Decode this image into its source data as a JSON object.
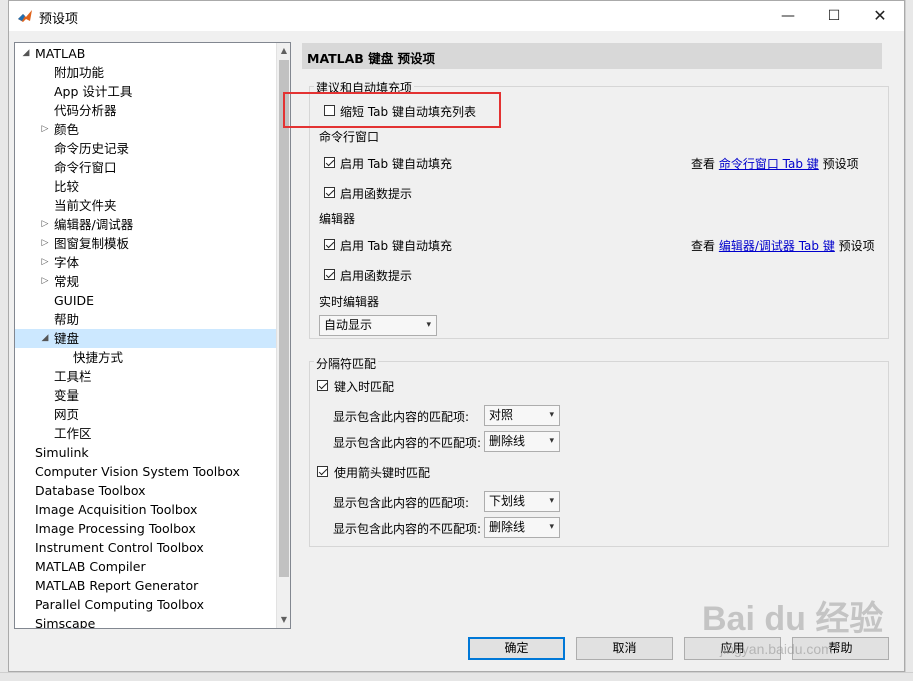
{
  "window": {
    "title": "预设项",
    "minimize": "—",
    "maximize": "☐",
    "close": "✕"
  },
  "tree": {
    "items": [
      {
        "label": "MATLAB",
        "expander": "◢"
      },
      {
        "label": "附加功能"
      },
      {
        "label": "App 设计工具"
      },
      {
        "label": "代码分析器"
      },
      {
        "label": "颜色",
        "expander": "▷"
      },
      {
        "label": "命令历史记录"
      },
      {
        "label": "命令行窗口"
      },
      {
        "label": "比较"
      },
      {
        "label": "当前文件夹"
      },
      {
        "label": "编辑器/调试器",
        "expander": "▷"
      },
      {
        "label": "图窗复制模板",
        "expander": "▷"
      },
      {
        "label": "字体",
        "expander": "▷"
      },
      {
        "label": "常规",
        "expander": "▷"
      },
      {
        "label": "GUIDE"
      },
      {
        "label": "帮助"
      },
      {
        "label": "键盘",
        "expander": "◢",
        "selected": true
      },
      {
        "label": "快捷方式"
      },
      {
        "label": "工具栏"
      },
      {
        "label": "变量"
      },
      {
        "label": "网页"
      },
      {
        "label": "工作区"
      },
      {
        "label": "Simulink"
      },
      {
        "label": "Computer Vision System Toolbox"
      },
      {
        "label": "Database Toolbox"
      },
      {
        "label": "Image Acquisition Toolbox"
      },
      {
        "label": "Image Processing Toolbox"
      },
      {
        "label": "Instrument Control Toolbox"
      },
      {
        "label": "MATLAB Compiler"
      },
      {
        "label": "MATLAB Report Generator"
      },
      {
        "label": "Parallel Computing Toolbox"
      },
      {
        "label": "Simscape"
      }
    ]
  },
  "panel": {
    "header": "MATLAB 键盘 预设项",
    "tab_completion": {
      "group_label": "建议和自动填充项",
      "shorten_list": {
        "label": "缩短 Tab 键自动填充列表",
        "checked": false
      },
      "command_window": {
        "label": "命令行窗口",
        "enable_tab": {
          "label": "启用 Tab 键自动填充",
          "checked": true
        },
        "function_hints": {
          "label": "启用函数提示",
          "checked": true
        },
        "see_prefix": "查看",
        "see_link": "命令行窗口 Tab 键",
        "see_suffix": "预设项"
      },
      "editor": {
        "label": "编辑器",
        "enable_tab": {
          "label": "启用 Tab 键自动填充",
          "checked": true
        },
        "function_hints": {
          "label": "启用函数提示",
          "checked": true
        },
        "see_prefix": "查看",
        "see_link": "编辑器/调试器 Tab 键",
        "see_suffix": "预设项"
      },
      "live_editor": {
        "label": "实时编辑器",
        "value": "自动显示"
      }
    },
    "delimiter": {
      "group_label": "分隔符匹配",
      "on_type": {
        "label": "键入时匹配",
        "checked": true
      },
      "on_type_match": {
        "label": "显示包含此内容的匹配项:",
        "value": "对照"
      },
      "on_type_mismatch": {
        "label": "显示包含此内容的不匹配项:",
        "value": "删除线"
      },
      "on_arrow": {
        "label": "使用箭头键时匹配",
        "checked": true
      },
      "on_arrow_match": {
        "label": "显示包含此内容的匹配项:",
        "value": "下划线"
      },
      "on_arrow_mismatch": {
        "label": "显示包含此内容的不匹配项:",
        "value": "删除线"
      }
    }
  },
  "buttons": {
    "ok": "确定",
    "cancel": "取消",
    "apply": "应用",
    "help": "帮助"
  },
  "watermark": {
    "text": "Bai du 经验",
    "url": "jingyan.baidu.com"
  },
  "colors": {
    "selection": "#cce8ff",
    "link": "#0000cc",
    "highlight_box": "#e33232"
  }
}
